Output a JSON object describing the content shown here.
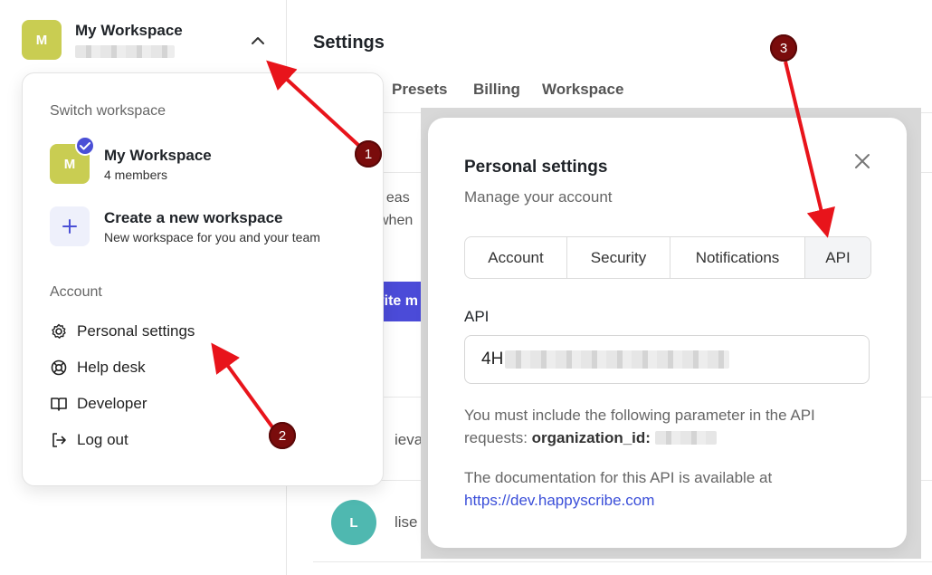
{
  "sidebar": {
    "workspace_avatar": "M",
    "workspace_name": "My Workspace",
    "chevron": "chevron-up-icon"
  },
  "main": {
    "title": "Settings",
    "tabs": [
      {
        "label": "Presets"
      },
      {
        "label": "Billing"
      },
      {
        "label": "Workspace"
      }
    ],
    "bg_text_1": "t eas",
    "bg_text_2": "when",
    "invite_button": "vite m",
    "member_1": "ieva",
    "member_2_avatar": "L",
    "member_2": "lise"
  },
  "dropdown": {
    "switch_heading": "Switch workspace",
    "current_workspace": {
      "avatar": "M",
      "name": "My Workspace",
      "members": "4 members"
    },
    "create_workspace": {
      "title": "Create a new workspace",
      "subtitle": "New workspace for you and your team"
    },
    "account_heading": "Account",
    "menu_items": [
      {
        "label": "Personal settings",
        "icon": "gear-icon"
      },
      {
        "label": "Help desk",
        "icon": "lifebuoy-icon"
      },
      {
        "label": "Developer",
        "icon": "book-icon"
      },
      {
        "label": "Log out",
        "icon": "logout-icon"
      }
    ]
  },
  "modal": {
    "title": "Personal settings",
    "subtitle": "Manage your account",
    "tabs": [
      {
        "label": "Account"
      },
      {
        "label": "Security"
      },
      {
        "label": "Notifications"
      },
      {
        "label": "API",
        "active": true
      }
    ],
    "api_label": "API",
    "api_value_prefix": "4H",
    "info_text": "You must include the following parameter in the API requests:",
    "info_param": "organization_id:",
    "doc_text": "The documentation for this API is available at",
    "doc_link": "https://dev.happyscribe.com"
  },
  "annotations": {
    "badge_1": "1",
    "badge_2": "2",
    "badge_3": "3"
  },
  "colors": {
    "accent": "#4b4bd8",
    "workspace_avatar": "#c9cd52",
    "badge": "#7a0c0c",
    "arrow": "#e8141b",
    "link": "#3b4fd9"
  }
}
